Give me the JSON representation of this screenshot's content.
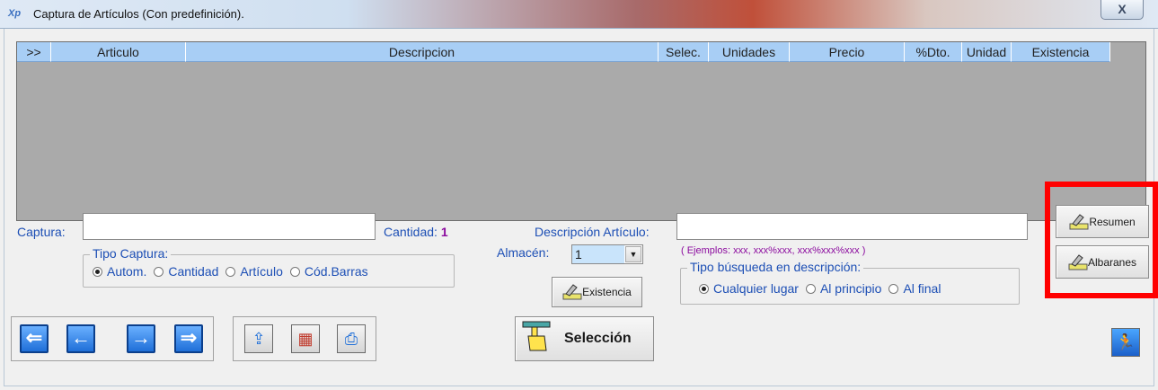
{
  "window": {
    "title": "Captura de Artículos (Con predefinición).",
    "close_label": "X",
    "app_icon_text": "Xp"
  },
  "grid": {
    "columns": [
      {
        "label": ">>",
        "key": "expand"
      },
      {
        "label": "Articulo",
        "key": "articulo"
      },
      {
        "label": "Descripcion",
        "key": "descripcion"
      },
      {
        "label": "Selec.",
        "key": "selec"
      },
      {
        "label": "Unidades",
        "key": "unidades"
      },
      {
        "label": "Precio",
        "key": "precio"
      },
      {
        "label": "%Dto.",
        "key": "dto"
      },
      {
        "label": "Unidad",
        "key": "unidad"
      },
      {
        "label": "Existencia",
        "key": "existencia"
      }
    ],
    "scroll_button": "<"
  },
  "form": {
    "captura_label": "Captura:",
    "captura_value": "",
    "cantidad_label": "Cantidad:",
    "cantidad_value": "1",
    "tipo_captura_legend": "Tipo Captura:",
    "tipo_captura_options": [
      "Autom.",
      "Cantidad",
      "Artículo",
      "Cód.Barras"
    ],
    "tipo_captura_selected": "Autom.",
    "descripcion_label": "Descripción Artículo:",
    "descripcion_value": "",
    "ejemplos": "( Ejemplos: xxx,   xxx%xxx,   xxx%xxx%xxx )",
    "almacen_label": "Almacén:",
    "almacen_value": "1",
    "existencia_button": "Existencia",
    "tipo_busqueda_legend": "Tipo búsqueda en descripción:",
    "tipo_busqueda_options": [
      "Cualquier lugar",
      "Al principio",
      "Al final"
    ],
    "tipo_busqueda_selected": "Cualquier lugar"
  },
  "side_buttons": {
    "resumen": "Resumen",
    "albaranes": "Albaranes"
  },
  "bottom": {
    "seleccion_button": "Selección",
    "nav_icons": [
      "arrow-first-icon",
      "arrow-prev-icon",
      "arrow-next-icon",
      "arrow-last-icon"
    ],
    "tool_icons": [
      "upload-icon",
      "cube-icon",
      "printer-icon"
    ],
    "exit_icon": "running-man-icon"
  },
  "colors": {
    "label_blue": "#1d4fb5",
    "value_purple": "#8b0a9e",
    "grid_bg": "#aaaaaa",
    "header_bg": "#a8cef5",
    "highlight_red": "#ff0000"
  }
}
